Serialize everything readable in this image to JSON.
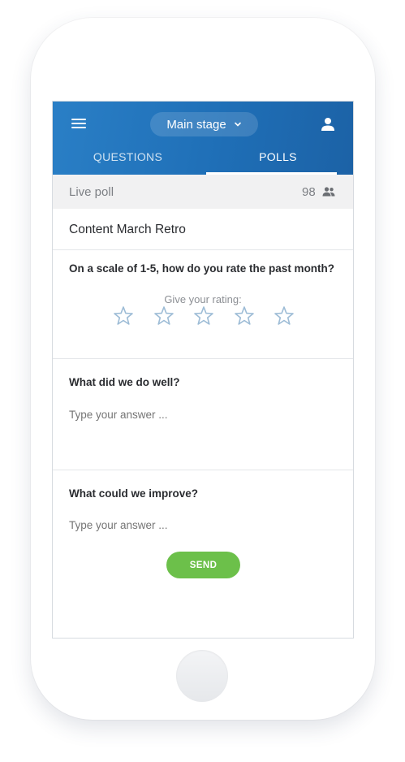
{
  "header": {
    "stage_label": "Main stage",
    "tabs": [
      {
        "label": "QUESTIONS",
        "active": false
      },
      {
        "label": "POLLS",
        "active": true
      }
    ]
  },
  "live_bar": {
    "label": "Live poll",
    "participant_count": "98"
  },
  "poll": {
    "title": "Content March Retro",
    "questions": [
      {
        "text": "On a scale of 1-5, how do you rate the past month?",
        "rating_hint": "Give your rating:",
        "rating_max": 5,
        "rating_value": 0
      },
      {
        "text": "What did we do well?",
        "placeholder": "Type your answer ..."
      },
      {
        "text": "What could we improve?",
        "placeholder": "Type your answer ..."
      }
    ],
    "send_label": "SEND"
  },
  "colors": {
    "header_blue": "#1f6fb7",
    "send_green": "#6cc04a",
    "star_outline": "#9dbcd6"
  },
  "icons": [
    "menu-icon",
    "chevron-down-icon",
    "user-icon",
    "people-icon",
    "star-icon"
  ]
}
